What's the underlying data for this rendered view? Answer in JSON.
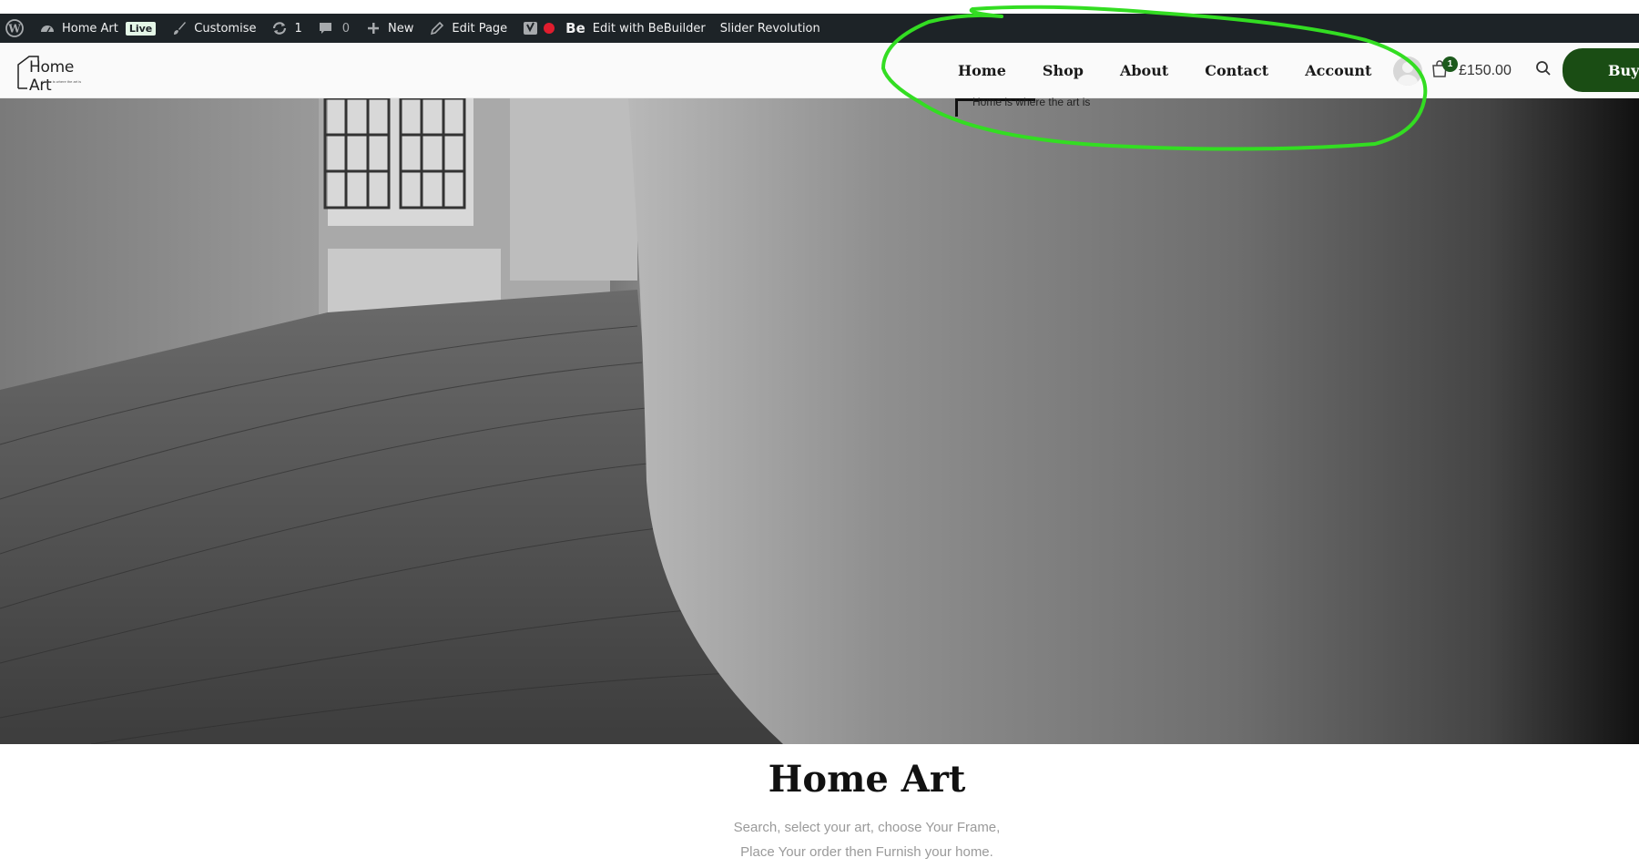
{
  "adminbar": {
    "site_name": "Home Art",
    "live_badge": "Live",
    "customise": "Customise",
    "updates_count": "1",
    "comments_count": "0",
    "new": "New",
    "edit_page": "Edit Page",
    "bebuilder_logo": "Be",
    "bebuilder": "Edit with BeBuilder",
    "slider": "Slider Revolution"
  },
  "logo": {
    "text": "Home Art",
    "tagline": "Home is where the art is"
  },
  "nav": {
    "items": [
      {
        "label": "Home"
      },
      {
        "label": "Shop"
      },
      {
        "label": "About"
      },
      {
        "label": "Contact"
      },
      {
        "label": "Account"
      }
    ]
  },
  "header": {
    "cart_count": "1",
    "cart_total": "£150.00",
    "buy_label": "Buy"
  },
  "submenu": {
    "text": "Home is where the art is"
  },
  "content": {
    "title": "Home Art",
    "subtitle_line1": "Search, select your art, choose Your Frame,",
    "subtitle_line2": "Place Your order then Furnish your home."
  },
  "colors": {
    "adminbar_bg": "#1d2327",
    "buy_button": "#1a4d14",
    "cart_badge": "#1d5a1d",
    "annotation": "#33dd22"
  }
}
